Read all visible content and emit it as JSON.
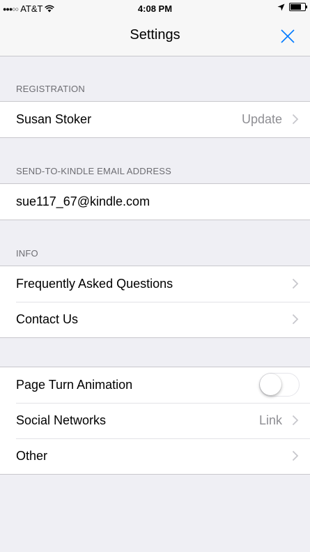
{
  "status": {
    "carrier": "AT&T",
    "time": "4:08 PM"
  },
  "nav": {
    "title": "Settings",
    "close_icon": "close-icon"
  },
  "registration": {
    "header": "REGISTRATION",
    "name": "Susan Stoker",
    "action": "Update"
  },
  "kindle": {
    "header": "SEND-TO-KINDLE EMAIL ADDRESS",
    "email": "sue117_67@kindle.com"
  },
  "info": {
    "header": "INFO",
    "items": [
      {
        "label": "Frequently Asked Questions"
      },
      {
        "label": "Contact Us"
      }
    ]
  },
  "prefs": {
    "page_turn": {
      "label": "Page Turn Animation",
      "enabled": false
    },
    "social": {
      "label": "Social Networks",
      "detail": "Link"
    },
    "other": {
      "label": "Other"
    }
  },
  "colors": {
    "accent": "#007aff",
    "background": "#efeff4",
    "secondary_text": "#8e8e93"
  }
}
